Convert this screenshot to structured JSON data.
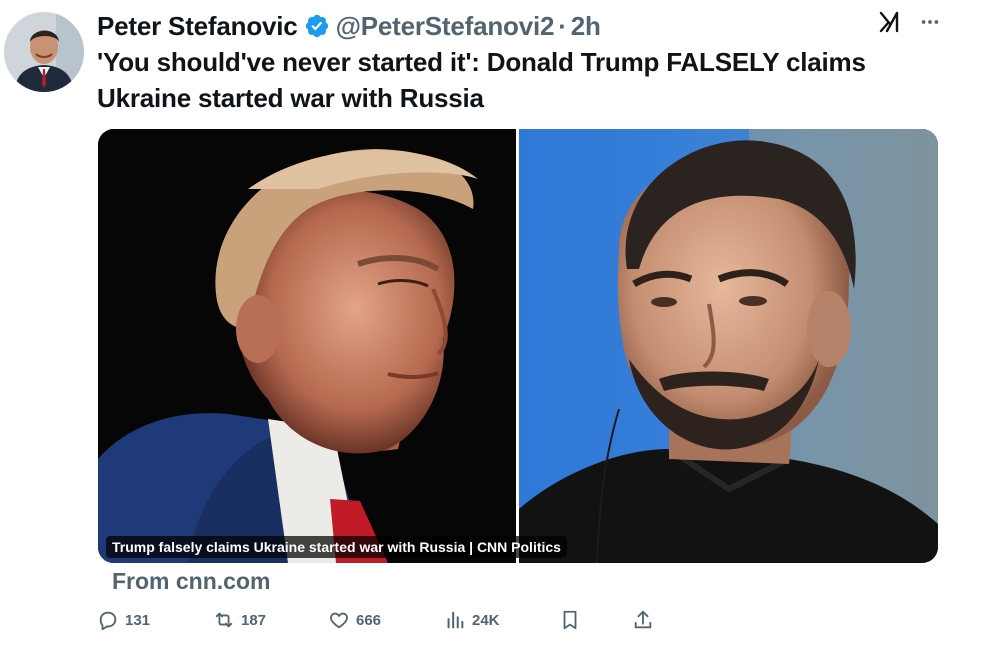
{
  "post": {
    "author_name": "Peter Stefanovic",
    "author_handle": "@PeterStefanovi2",
    "separator": "·",
    "time": "2h",
    "text": "'You should've never started it': Donald Trump FALSELY claims Ukraine started war with Russia"
  },
  "card": {
    "caption": "Trump falsely claims Ukraine started war with Russia | CNN Politics",
    "source": "From cnn.com"
  },
  "actions": {
    "replies": "131",
    "reposts": "187",
    "likes": "666",
    "views": "24K"
  },
  "icons": {
    "verified": "verified-badge-icon",
    "grok": "grok-icon",
    "more": "more-icon",
    "reply": "reply-icon",
    "repost": "repost-icon",
    "like": "heart-icon",
    "views": "views-icon",
    "bookmark": "bookmark-icon",
    "share": "share-icon"
  },
  "colors": {
    "text": "#0f1419",
    "secondary": "#536471",
    "verified": "#1d9bf0"
  }
}
